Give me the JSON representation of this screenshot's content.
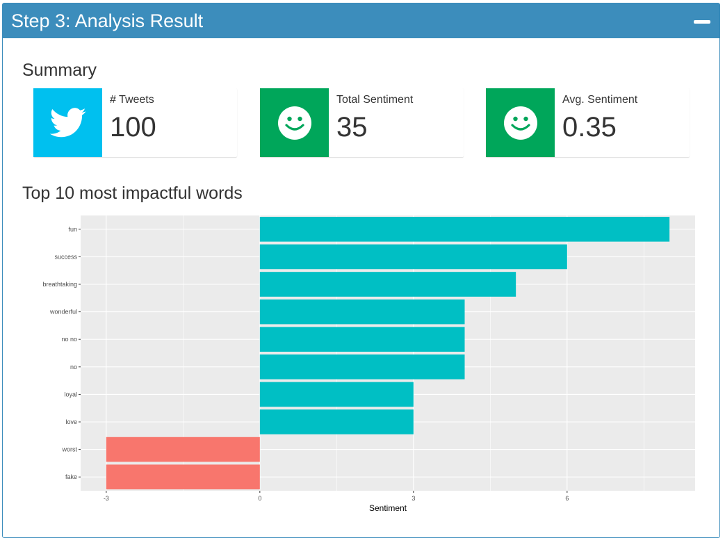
{
  "header": {
    "title": "Step 3: Analysis Result",
    "collapse_icon": "minus-icon"
  },
  "summary": {
    "heading": "Summary",
    "cards": [
      {
        "label": "# Tweets",
        "value": "100",
        "icon": "twitter-icon",
        "color": "#00c0ef"
      },
      {
        "label": "Total Sentiment",
        "value": "35",
        "icon": "smile-icon",
        "color": "#00a65a"
      },
      {
        "label": "Avg. Sentiment",
        "value": "0.35",
        "icon": "smile-icon",
        "color": "#00a65a"
      }
    ]
  },
  "words_section": {
    "heading": "Top 10 most impactful words"
  },
  "colors": {
    "header": "#3c8dbc",
    "positive": "#00bfc4",
    "negative": "#f8766d",
    "panel": "#ebebeb"
  },
  "chart_data": {
    "type": "bar",
    "orientation": "horizontal",
    "categories": [
      "fun",
      "success",
      "breathtaking",
      "wonderful",
      "no no",
      "no",
      "loyal",
      "love",
      "worst",
      "fake"
    ],
    "values": [
      8,
      6,
      5,
      4,
      4,
      4,
      3,
      3,
      -3,
      -3
    ],
    "xlabel": "Sentiment",
    "ylabel": "",
    "xlim": [
      -3.5,
      8.5
    ],
    "xticks": [
      -3,
      0,
      3,
      6
    ],
    "grid": true,
    "legend": "none"
  }
}
